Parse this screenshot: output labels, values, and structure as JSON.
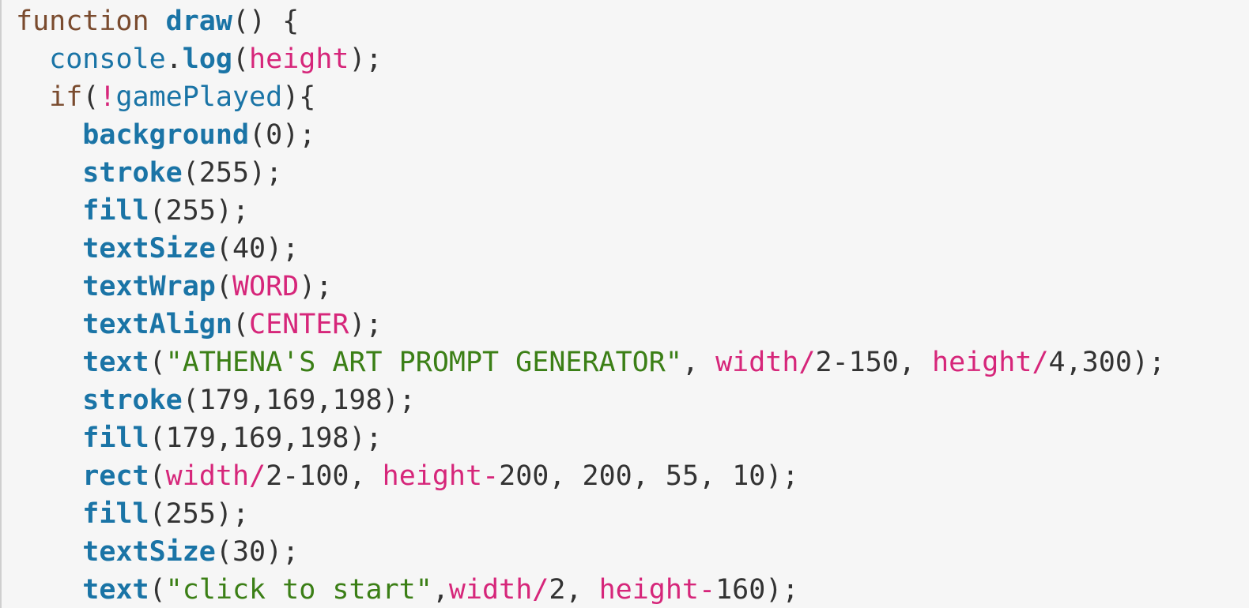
{
  "editor": {
    "lines": [
      [
        [
          "kw",
          "function "
        ],
        [
          "fn",
          "draw"
        ],
        [
          "pn",
          "() {"
        ]
      ],
      [
        [
          "pn",
          "  "
        ],
        [
          "ctx",
          "console"
        ],
        [
          "pn",
          "."
        ],
        [
          "fn",
          "log"
        ],
        [
          "pn",
          "("
        ],
        [
          "var",
          "height"
        ],
        [
          "pn",
          ");"
        ]
      ],
      [
        [
          "pn",
          "  "
        ],
        [
          "kw",
          "if"
        ],
        [
          "pn",
          "("
        ],
        [
          "op",
          "!"
        ],
        [
          "ctx",
          "gamePlayed"
        ],
        [
          "pn",
          "){"
        ]
      ],
      [
        [
          "pn",
          "    "
        ],
        [
          "fn",
          "background"
        ],
        [
          "pn",
          "("
        ],
        [
          "num",
          "0"
        ],
        [
          "pn",
          ");"
        ]
      ],
      [
        [
          "pn",
          "    "
        ],
        [
          "fn",
          "stroke"
        ],
        [
          "pn",
          "("
        ],
        [
          "num",
          "255"
        ],
        [
          "pn",
          ");"
        ]
      ],
      [
        [
          "pn",
          "    "
        ],
        [
          "fn",
          "fill"
        ],
        [
          "pn",
          "("
        ],
        [
          "num",
          "255"
        ],
        [
          "pn",
          ");"
        ]
      ],
      [
        [
          "pn",
          "    "
        ],
        [
          "fn",
          "textSize"
        ],
        [
          "pn",
          "("
        ],
        [
          "num",
          "40"
        ],
        [
          "pn",
          ");"
        ]
      ],
      [
        [
          "pn",
          "    "
        ],
        [
          "fn",
          "textWrap"
        ],
        [
          "pn",
          "("
        ],
        [
          "var",
          "WORD"
        ],
        [
          "pn",
          ");"
        ]
      ],
      [
        [
          "pn",
          "    "
        ],
        [
          "fn",
          "textAlign"
        ],
        [
          "pn",
          "("
        ],
        [
          "var",
          "CENTER"
        ],
        [
          "pn",
          ");"
        ]
      ],
      [
        [
          "pn",
          "    "
        ],
        [
          "fn",
          "text"
        ],
        [
          "pn",
          "("
        ],
        [
          "str",
          "\"ATHENA'S ART PROMPT GENERATOR\""
        ],
        [
          "pn",
          ", "
        ],
        [
          "var",
          "width"
        ],
        [
          "op",
          "/"
        ],
        [
          "num",
          "2-150"
        ],
        [
          "pn",
          ", "
        ],
        [
          "var",
          "height"
        ],
        [
          "op",
          "/"
        ],
        [
          "num",
          "4,300"
        ],
        [
          "pn",
          ");"
        ]
      ],
      [
        [
          "pn",
          "    "
        ],
        [
          "fn",
          "stroke"
        ],
        [
          "pn",
          "("
        ],
        [
          "num",
          "179,169,198"
        ],
        [
          "pn",
          ");"
        ]
      ],
      [
        [
          "pn",
          "    "
        ],
        [
          "fn",
          "fill"
        ],
        [
          "pn",
          "("
        ],
        [
          "num",
          "179,169,198"
        ],
        [
          "pn",
          ");"
        ]
      ],
      [
        [
          "pn",
          "    "
        ],
        [
          "fn",
          "rect"
        ],
        [
          "pn",
          "("
        ],
        [
          "var",
          "width"
        ],
        [
          "op",
          "/"
        ],
        [
          "num",
          "2-100"
        ],
        [
          "pn",
          ", "
        ],
        [
          "var",
          "height"
        ],
        [
          "op",
          "-"
        ],
        [
          "num",
          "200"
        ],
        [
          "pn",
          ", "
        ],
        [
          "num",
          "200"
        ],
        [
          "pn",
          ", "
        ],
        [
          "num",
          "55"
        ],
        [
          "pn",
          ", "
        ],
        [
          "num",
          "10"
        ],
        [
          "pn",
          ");"
        ]
      ],
      [
        [
          "pn",
          "    "
        ],
        [
          "fn",
          "fill"
        ],
        [
          "pn",
          "("
        ],
        [
          "num",
          "255"
        ],
        [
          "pn",
          ");"
        ]
      ],
      [
        [
          "pn",
          "    "
        ],
        [
          "fn",
          "textSize"
        ],
        [
          "pn",
          "("
        ],
        [
          "num",
          "30"
        ],
        [
          "pn",
          ");"
        ]
      ],
      [
        [
          "pn",
          "    "
        ],
        [
          "fn",
          "text"
        ],
        [
          "pn",
          "("
        ],
        [
          "str",
          "\"click to start\""
        ],
        [
          "pn",
          ","
        ],
        [
          "var",
          "width"
        ],
        [
          "op",
          "/"
        ],
        [
          "num",
          "2"
        ],
        [
          "pn",
          ", "
        ],
        [
          "var",
          "height"
        ],
        [
          "op",
          "-"
        ],
        [
          "num",
          "160"
        ],
        [
          "pn",
          ");"
        ]
      ]
    ]
  },
  "colors": {
    "background": "#f6f6f6",
    "keyword": "#7a4b2e",
    "function": "#1a74a6",
    "string": "#3b7f16",
    "variable": "#d6267a",
    "plain": "#333333"
  }
}
